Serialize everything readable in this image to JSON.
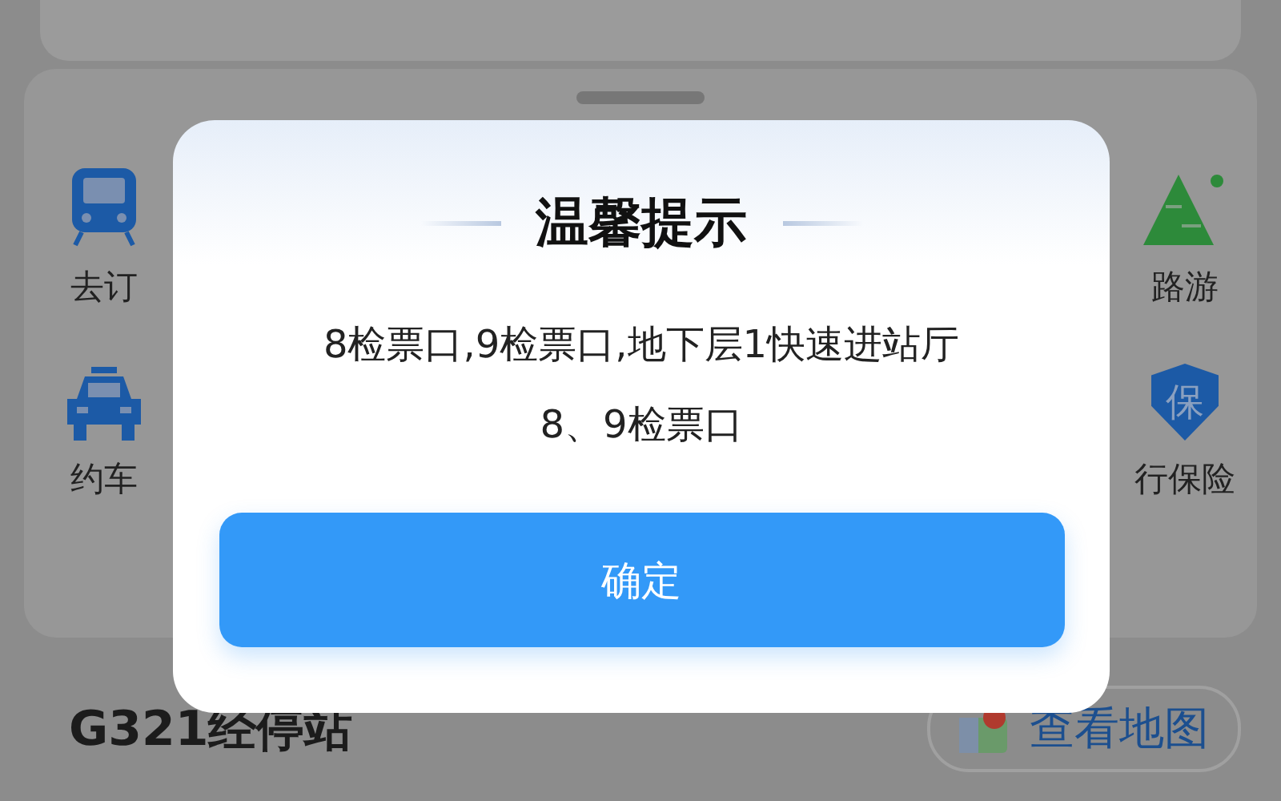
{
  "background": {
    "left_items": [
      {
        "label": "去订",
        "kind": "train"
      },
      {
        "label": "约车",
        "kind": "car"
      }
    ],
    "right_items": [
      {
        "label": "路游",
        "kind": "mountain"
      },
      {
        "label": "行保险",
        "kind": "shield",
        "glyph": "保"
      }
    ],
    "station_title": "G321经停站",
    "map_button": "查看地图"
  },
  "dialog": {
    "title": "温馨提示",
    "message": [
      "8检票口,9检票口,地下层1快速进站厅",
      "8、9检票口"
    ],
    "confirm": "确定"
  }
}
